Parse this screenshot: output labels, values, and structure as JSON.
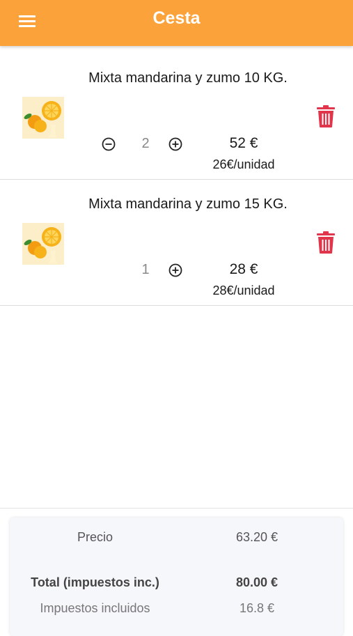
{
  "header": {
    "title": "Cesta",
    "menu_icon": "menu-icon",
    "color": "#fba23a"
  },
  "cart": {
    "items": [
      {
        "name": "Mixta mandarina y zumo 10 KG.",
        "quantity": "2",
        "price": "52 €",
        "unit_price": "26€/unidad",
        "image_icon": "orange-product-image"
      },
      {
        "name": "Mixta mandarina y zumo 15 KG.",
        "quantity": "1",
        "price": "28 €",
        "unit_price": "28€/unidad",
        "image_icon": "orange-product-image"
      }
    ]
  },
  "summary": {
    "price_label": "Precio",
    "price_value": "63.20 €",
    "total_label": "Total (impuestos inc.)",
    "total_value": "80.00 €",
    "taxes_label": "Impuestos incluidos",
    "taxes_value": "16.8 €"
  },
  "colors": {
    "delete": "#e0354a",
    "summary_bg": "#f6f7fb"
  }
}
